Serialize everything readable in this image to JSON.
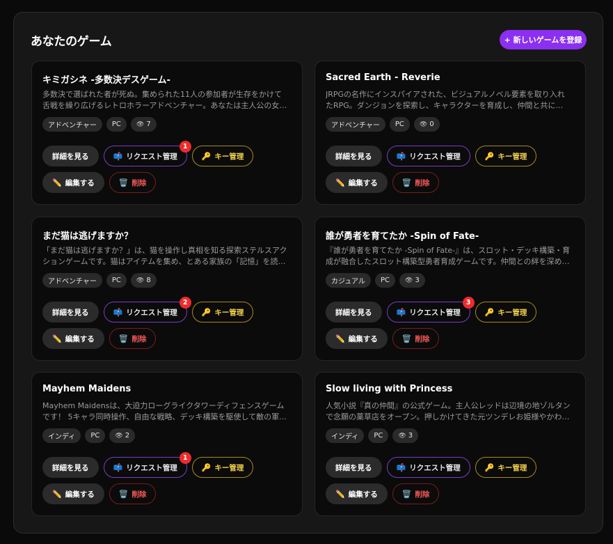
{
  "header": {
    "title": "あなたのゲーム",
    "new_button": "+ 新しいゲームを登録"
  },
  "labels": {
    "detail": "詳細を見る",
    "request": "リクエスト管理",
    "key": "キー管理",
    "edit": "編集する",
    "delete": "削除"
  },
  "icons": {
    "request": "mailbox-icon",
    "key": "key-icon",
    "edit": "pencil-icon",
    "delete": "trash-icon",
    "views": "eye-icon"
  },
  "games": [
    {
      "title": "キミガシネ -多数決デスゲーム-",
      "description": "多数決で選ばれた者が死ぬ。集められた11人の参加者が生存をかけて舌戦を繰り広げるレトロホラーアドベンチャー。あなたは主人公の女子高生として…",
      "genre": "アドベンチャー",
      "platform": "PC",
      "views": "7",
      "requests": "1"
    },
    {
      "title": "Sacred Earth - Reverie",
      "description": "JRPGの名作にインスパイアされた、ビジュアルノベル要素を取り入れたRPG。ダンジョンを探索し、キャラクターを育成し、仲間と共に失われた過去の歴史…",
      "genre": "アドベンチャー",
      "platform": "PC",
      "views": "0",
      "requests": ""
    },
    {
      "title": "まだ猫は逃げますか？",
      "description": "「まだ猫は逃げますか？」は、猫を操作し真相を知る探索ステルスアクションゲームです。猫はアイテムを集め、とある家族の「記憶」を読み、不思議な空…",
      "genre": "アドベンチャー",
      "platform": "PC",
      "views": "8",
      "requests": "2"
    },
    {
      "title": "誰が勇者を育てたか -Spin of Fate-",
      "description": "『誰が勇者を育てたか -Spin of Fate-』は、スロット・デッキ構築・育成が融合したスロット構築型勇者育成ゲームです。仲間との絆を深めながら、自由…",
      "genre": "カジュアル",
      "platform": "PC",
      "views": "3",
      "requests": "3"
    },
    {
      "title": "Mayhem Maidens",
      "description": "Mayhem Maidensは、大迫力ローグライクタワーディフェンスゲームです！ 5キャラ同時操作、自由な戦略、デッキ構築を駆使して敵の軍勢から拠点を守…",
      "genre": "インディ",
      "platform": "PC",
      "views": "2",
      "requests": "1"
    },
    {
      "title": "Slow living with Princess",
      "description": "人気小説『真の仲間』の公式ゲーム。主人公レッドは辺境の地ゾルタンで念願の薬草店をオープン。押しかけてきた元ツンデレお姫様やかわいい妹との幸…",
      "genre": "インディ",
      "platform": "PC",
      "views": "3",
      "requests": ""
    }
  ]
}
